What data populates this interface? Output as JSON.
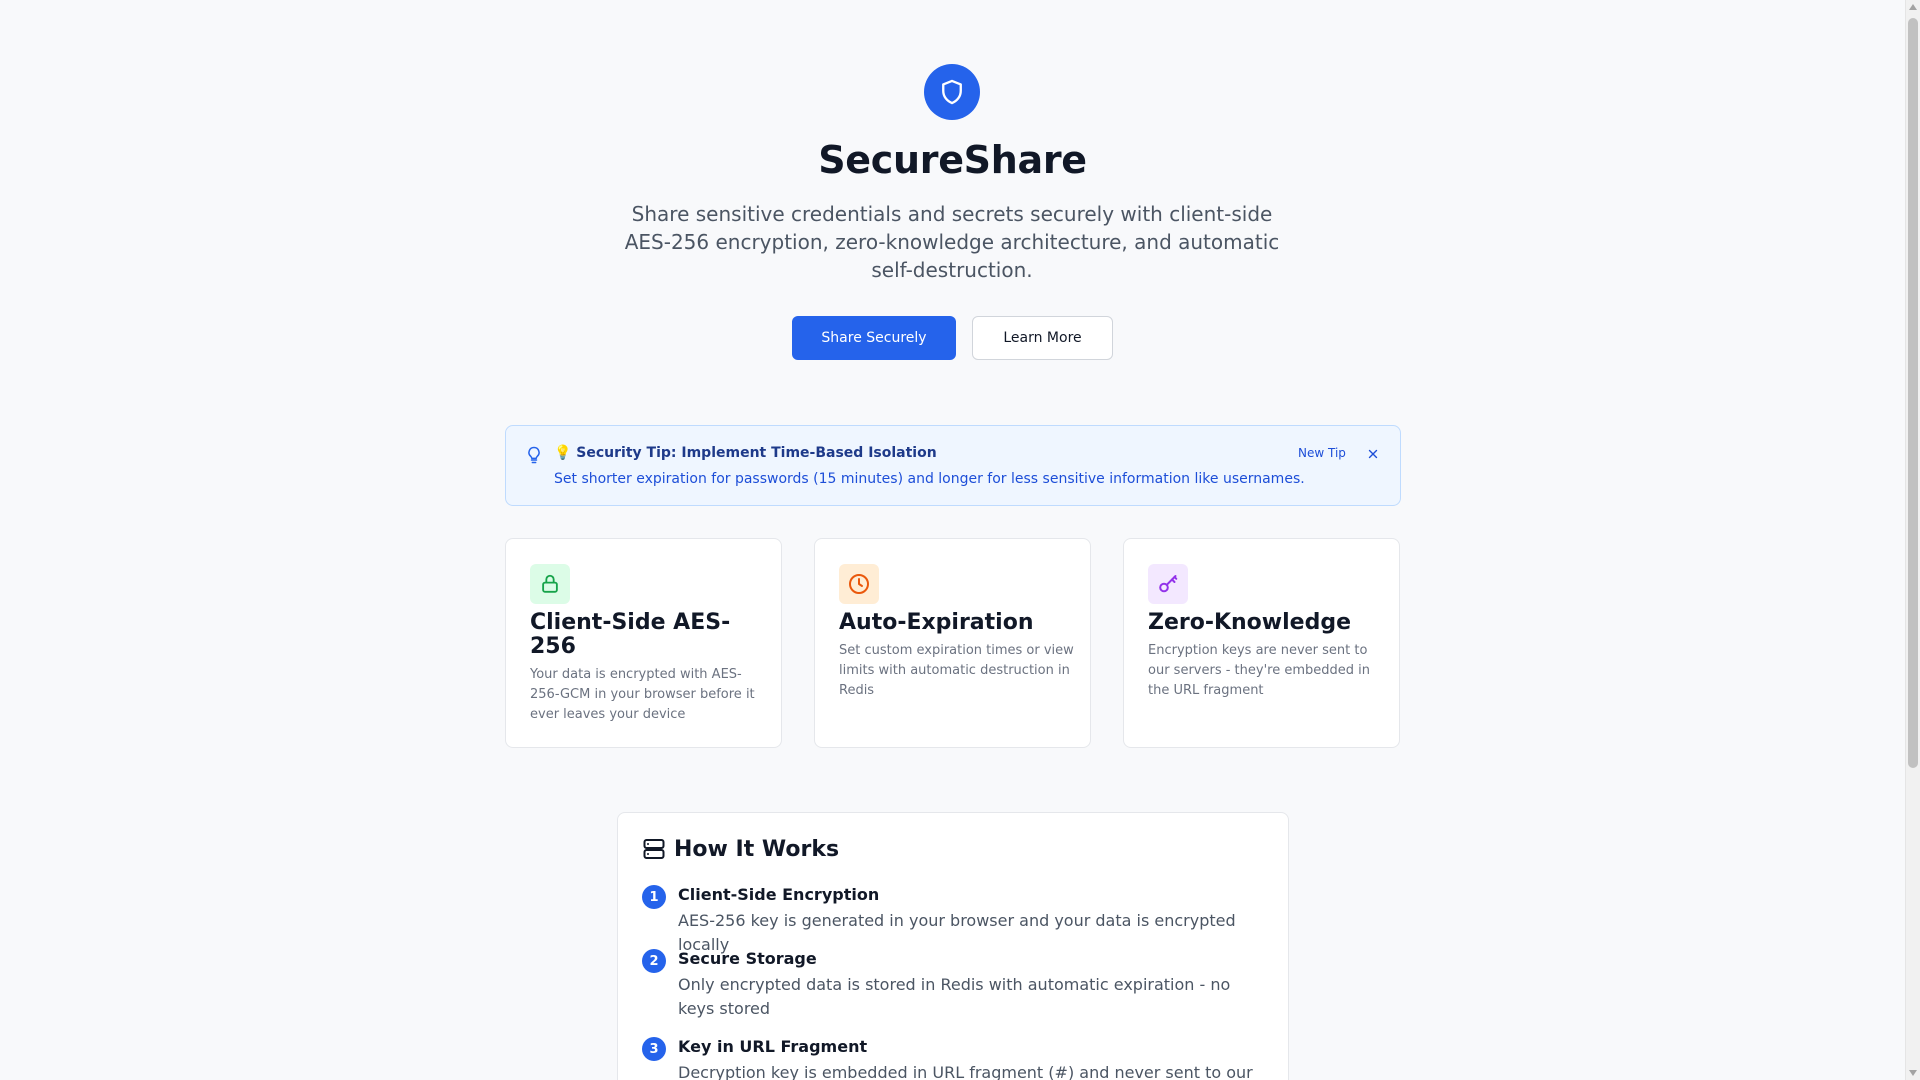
{
  "hero": {
    "title": "SecureShare",
    "subtitle": "Share sensitive credentials and secrets securely with client-side AES-256 encryption, zero-knowledge architecture, and automatic self-destruction.",
    "primary_button": "Share Securely",
    "secondary_button": "Learn More",
    "icon": "shield-icon"
  },
  "tip": {
    "title": "💡 Security Tip: Implement Time-Based Isolation",
    "text": "Set shorter expiration for passwords (15 minutes) and longer for less sensitive information like usernames.",
    "new_tip_label": "New Tip",
    "icon": "lightbulb-icon",
    "close_icon": "close-icon"
  },
  "features": [
    {
      "title": "Client-Side AES-256",
      "description": "Your data is encrypted with AES-256-GCM in your browser before it ever leaves your device",
      "icon": "lock-icon",
      "icon_color": "#16a34a",
      "icon_bg": "#dcfce7"
    },
    {
      "title": "Auto-Expiration",
      "description": "Set custom expiration times or view limits with automatic destruction in Redis",
      "icon": "clock-icon",
      "icon_color": "#ea580c",
      "icon_bg": "#ffedd5"
    },
    {
      "title": "Zero-Knowledge",
      "description": "Encryption keys are never sent to our servers - they're embedded in the URL fragment",
      "icon": "key-icon",
      "icon_color": "#9333ea",
      "icon_bg": "#f3e8ff"
    }
  ],
  "how_it_works": {
    "title": "How It Works",
    "icon": "server-icon",
    "steps": [
      {
        "number": "1",
        "title": "Client-Side Encryption",
        "description": "AES-256 key is generated in your browser and your data is encrypted locally"
      },
      {
        "number": "2",
        "title": "Secure Storage",
        "description": "Only encrypted data is stored in Redis with automatic expiration - no keys stored"
      },
      {
        "number": "3",
        "title": "Key in URL Fragment",
        "description": "Decryption key is embedded in URL fragment (#) and never sent to our servers"
      }
    ]
  },
  "colors": {
    "primary": "#2563eb",
    "background": "#f8f9fb",
    "tip_bg": "#eff6ff"
  }
}
